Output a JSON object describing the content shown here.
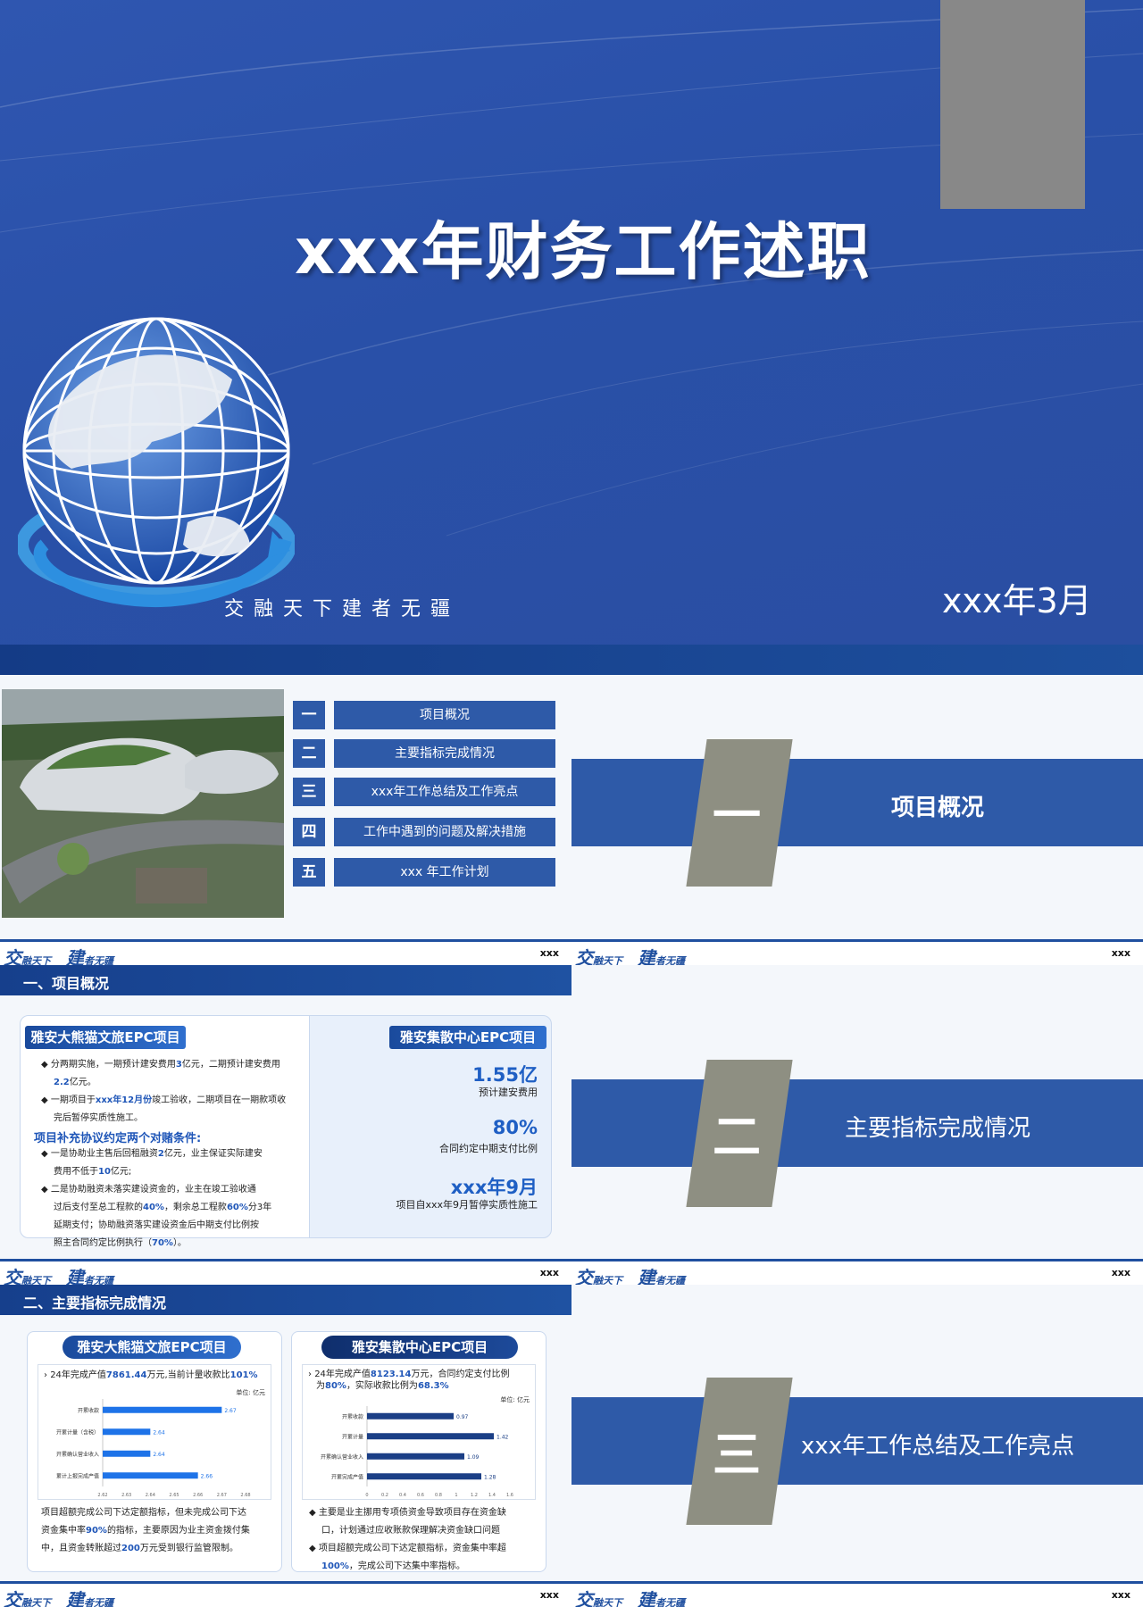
{
  "cover": {
    "title": "xxx年财务工作述职",
    "slogan": "交融天下建者无疆",
    "date": "xxx年3月"
  },
  "agenda": {
    "items": [
      {
        "num": "一",
        "label": "项目概况"
      },
      {
        "num": "二",
        "label": "主要指标完成情况"
      },
      {
        "num": "三",
        "label": "xxx年工作总结及工作亮点"
      },
      {
        "num": "四",
        "label": "工作中遇到的问题及解决措施"
      },
      {
        "num": "五",
        "label": "xxx 年工作计划"
      }
    ]
  },
  "sections": [
    {
      "num": "一",
      "title": "项目概况"
    },
    {
      "num": "二",
      "title": "主要指标完成情况"
    },
    {
      "num": "三",
      "title": "xxx年工作总结及工作亮点"
    }
  ],
  "footer": {
    "logo_a": "交",
    "logo_a_text": "融天下",
    "logo_b": "建",
    "logo_b_text": "者无疆",
    "right": "xxx"
  },
  "overview": {
    "header": "一、项目概况",
    "left_title": "雅安大熊猫文旅EPC项目",
    "b1_pre": "分两期实施，一期预计建安费用",
    "b1_v1": "3",
    "b1_mid": "亿元，二期预计建安费用",
    "b1_v2": "2.2",
    "b1_end": "亿元。",
    "b2_pre": "一期项目于",
    "b2_v": "xxx年12月份",
    "b2_mid": "竣工验收，二期项目在一期款项收",
    "b2_end": "完后暂停实质性施工。",
    "sub_heading": "项目补充协议约定两个对赌条件:",
    "b3_pre": "一是协助业主售后回租融资",
    "b3_v1": "2",
    "b3_mid": "亿元，业主保证实际建安",
    "b3_line2_pre": "费用不低于",
    "b3_v2": "10",
    "b3_end": "亿元;",
    "b4_l1": "二是协助融资未落实建设资金的，业主在竣工验收通",
    "b4_l2_pre": "过后支付至总工程款的",
    "b4_v1": "40%",
    "b4_l2_mid": "，剩余总工程款",
    "b4_v2": "60%",
    "b4_l2_end": "分3年",
    "b4_l3": "延期支付；协助融资落实建设资金后中期支付比例按",
    "b4_l4_pre": "照主合同约定比例执行（",
    "b4_v3": "70%",
    "b4_l4_end": "）。",
    "right_title": "雅安集散中心EPC项目",
    "stats": [
      {
        "value": "1.55亿",
        "label": "预计建安费用"
      },
      {
        "value": "80%",
        "label": "合同约定中期支付比例"
      },
      {
        "value": "xxx年9月",
        "label": "项目自xxx年9月暂停实质性施工"
      }
    ]
  },
  "indicators": {
    "header": "二、主要指标完成情况",
    "left": {
      "title": "雅安大熊猫文旅EPC项目",
      "note_pre": "24年完成产值",
      "note_v1": "7861.44",
      "note_mid": "万元,当前计量收款比",
      "note_v2": "101%",
      "unit": "单位: 亿元",
      "desc_l1": "项目超额完成公司下达定额指标，但未完成公司下达",
      "desc_l2_pre": "资金集中率",
      "desc_v1": "90%",
      "desc_l2_end": "的指标，主要原因为业主资金拨付集",
      "desc_l3_pre": "中，且资金转账超过",
      "desc_v2": "200",
      "desc_l3_end": "万元受到银行监管限制。"
    },
    "right": {
      "title": "雅安集散中心EPC项目",
      "note_l1_pre": "24年完成产值",
      "note_v1": "8123.14",
      "note_l1_end": "万元，合同约定支付比例",
      "note_l2_pre": "为",
      "note_v2": "80%",
      "note_l2_mid": "，实际收款比例为",
      "note_v3": "68.3%",
      "unit": "单位: 亿元",
      "b1_l1": "主要是业主挪用专项债资金导致项目存在资金缺",
      "b1_l2": "口，计划通过应收账款保理解决资金缺口问题",
      "b2_l1": "项目超额完成公司下达定额指标，资金集中率超",
      "b2_v": "100%",
      "b2_l2_end": "，完成公司下达集中率指标。"
    }
  },
  "chart_data": [
    {
      "type": "bar",
      "orientation": "horizontal",
      "categories": [
        "开累收款",
        "开累计量（含税）",
        "开累确认营业收入",
        "累计上报完成产值"
      ],
      "values": [
        2.67,
        2.64,
        2.64,
        2.66
      ],
      "xlim": [
        2.62,
        2.68
      ],
      "ticks": [
        "2.62",
        "2.63",
        "2.64",
        "2.65",
        "2.66",
        "2.67",
        "2.68"
      ],
      "color": "#1e73e8"
    },
    {
      "type": "bar",
      "orientation": "horizontal",
      "categories": [
        "开累收款",
        "开累计量",
        "开累确认营业收入",
        "开累完成产值"
      ],
      "values": [
        0.97,
        1.42,
        1.09,
        1.28
      ],
      "xlim": [
        0,
        1.6
      ],
      "ticks": [
        "0",
        "0.2",
        "0.4",
        "0.6",
        "0.8",
        "1",
        "1.2",
        "1.4",
        "1.6"
      ],
      "color": "#1b3f86"
    }
  ]
}
